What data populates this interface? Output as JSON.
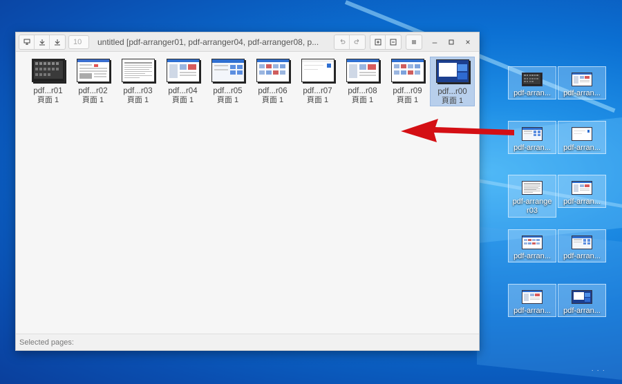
{
  "window": {
    "title": "untitled [pdf-arranger01, pdf-arranger04, pdf-arranger08, p...",
    "page_number_placeholder": "10",
    "status_text": "Selected pages:"
  },
  "pages": [
    {
      "name": "pdf...r01",
      "page": "頁面 1",
      "style": "dark"
    },
    {
      "name": "pdf...r02",
      "page": "頁面 1",
      "style": "doc"
    },
    {
      "name": "pdf...r03",
      "page": "頁面 1",
      "style": "text"
    },
    {
      "name": "pdf...r04",
      "page": "頁面 1",
      "style": "web"
    },
    {
      "name": "pdf...r05",
      "page": "頁面 1",
      "style": "blue"
    },
    {
      "name": "pdf...r06",
      "page": "頁面 1",
      "style": "grid"
    },
    {
      "name": "pdf...r07",
      "page": "頁面 1",
      "style": "plain"
    },
    {
      "name": "pdf...r08",
      "page": "頁面 1",
      "style": "web"
    },
    {
      "name": "pdf...r09",
      "page": "頁面 1",
      "style": "grid"
    },
    {
      "name": "pdf...r00",
      "page": "頁面 1",
      "style": "selblue",
      "selected": true
    }
  ],
  "desktop_icons": [
    {
      "label": "pdf-arran..."
    },
    {
      "label": "pdf-arran..."
    },
    {
      "label": "pdf-arran..."
    },
    {
      "label": "pdf-arran..."
    },
    {
      "label": "pdf-arrange r03"
    },
    {
      "label": "pdf-arran..."
    },
    {
      "label": "pdf-arran..."
    },
    {
      "label": "pdf-arran..."
    },
    {
      "label": "pdf-arran..."
    },
    {
      "label": "pdf-arran..."
    }
  ],
  "colors": {
    "arrow": "#d40f14",
    "selection": "#b8cfec"
  },
  "icons": {
    "toolbar": [
      "insert-icon",
      "import-icon",
      "export-icon",
      "undo-icon",
      "redo-icon",
      "zoom-in-icon",
      "zoom-out-icon",
      "menu-icon"
    ],
    "window_controls": [
      "minimize-icon",
      "maximize-icon",
      "close-icon"
    ]
  }
}
